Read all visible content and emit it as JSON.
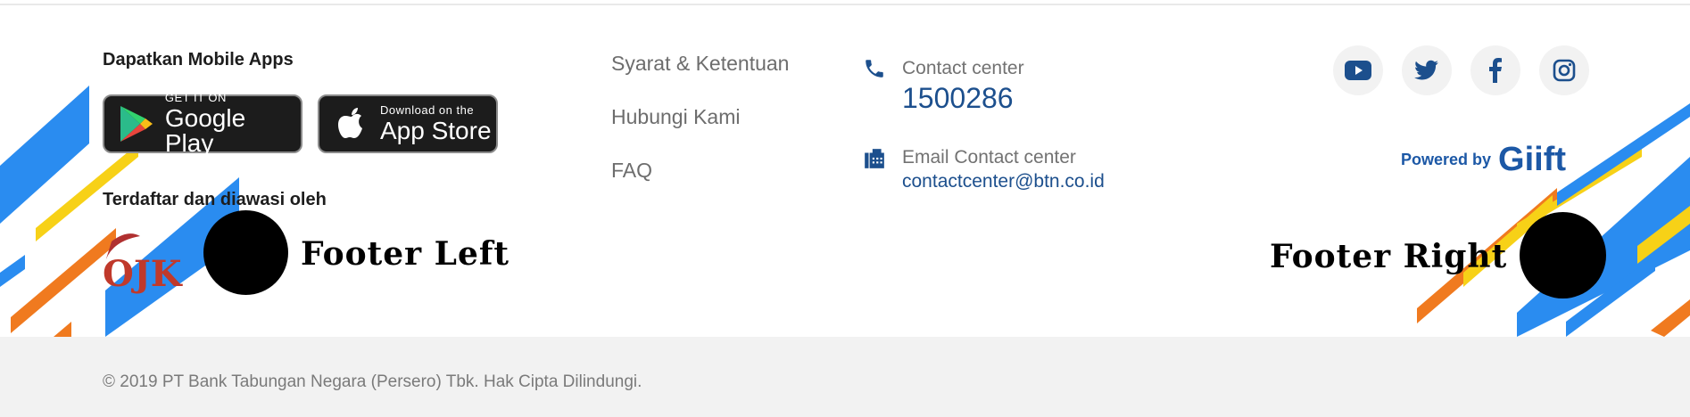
{
  "mobile_apps": {
    "title": "Dapatkan Mobile Apps",
    "google_play": {
      "small": "GET IT ON",
      "big": "Google Play"
    },
    "app_store": {
      "small": "Download on the",
      "big": "App Store"
    }
  },
  "registration": {
    "title": "Terdaftar dan diawasi oleh",
    "logo": "OJK"
  },
  "labels": {
    "footer_left": "Footer Left",
    "footer_right": "Footer Right"
  },
  "links": [
    "Syarat & Ketentuan",
    "Hubungi Kami",
    "FAQ"
  ],
  "contact": {
    "phone_label": "Contact center",
    "phone_number": "1500286",
    "email_label": "Email Contact center",
    "email": "contactcenter@btn.co.id"
  },
  "social": [
    "youtube-icon",
    "twitter-icon",
    "facebook-icon",
    "instagram-icon"
  ],
  "powered_by": {
    "text": "Powered by",
    "brand": "Giift"
  },
  "copyright": "© 2019 PT Bank Tabungan Negara (Persero) Tbk. Hak Cipta Dilindungi.",
  "colors": {
    "accent_blue": "#1c4f8d",
    "stripe_blue": "#2a8cf0",
    "stripe_yellow": "#f7d117",
    "stripe_orange": "#f07a1f",
    "bar_gray": "#f2f2f2"
  }
}
